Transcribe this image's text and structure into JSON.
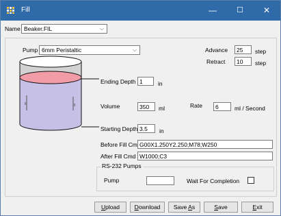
{
  "window": {
    "title": "Fill",
    "minimize_glyph": "—",
    "maximize_glyph": "☐",
    "close_glyph": "✕",
    "icon": "grid-app-icon"
  },
  "name_field": {
    "label": "Name",
    "value": "Beaker.FIL"
  },
  "pump": {
    "label": "Pump",
    "value": "6mm Peristaltic"
  },
  "advance": {
    "label": "Advance",
    "value": "25",
    "unit": "step"
  },
  "retract": {
    "label": "Retract",
    "value": "10",
    "unit": "step"
  },
  "ending_depth": {
    "label": "Ending Depth",
    "value": "1",
    "unit": "in"
  },
  "volume": {
    "label": "Volume",
    "value": "350",
    "unit": "ml"
  },
  "rate": {
    "label": "Rate",
    "value": "6",
    "unit": "ml / Second"
  },
  "starting_depth": {
    "label": "Starting Depth",
    "value": "3.5",
    "unit": "in"
  },
  "before_fill": {
    "label": "Before Fill Cmd",
    "value": "G00X1.250Y2.250;M78;W250"
  },
  "after_fill": {
    "label": "After Fill Cmd",
    "value": "W1000;C3"
  },
  "rs232": {
    "legend": "RS-232 Pumps",
    "pump_label": "Pump",
    "pump_value": "",
    "wait_label": "Wait For Completion",
    "wait_checked": false
  },
  "buttons": {
    "upload": {
      "accel": "U",
      "rest": "pload"
    },
    "download": {
      "accel": "D",
      "rest": "ownload"
    },
    "save_as": {
      "prefix": "Save ",
      "accel": "A",
      "rest": "s"
    },
    "save": {
      "accel": "S",
      "rest": "ave"
    },
    "exit": {
      "accel": "E",
      "rest": "xit"
    }
  },
  "colors": {
    "titlebar": "#2f6ba8",
    "liquid": "#c7c0e6",
    "liquid_top": "#f19ca7"
  }
}
